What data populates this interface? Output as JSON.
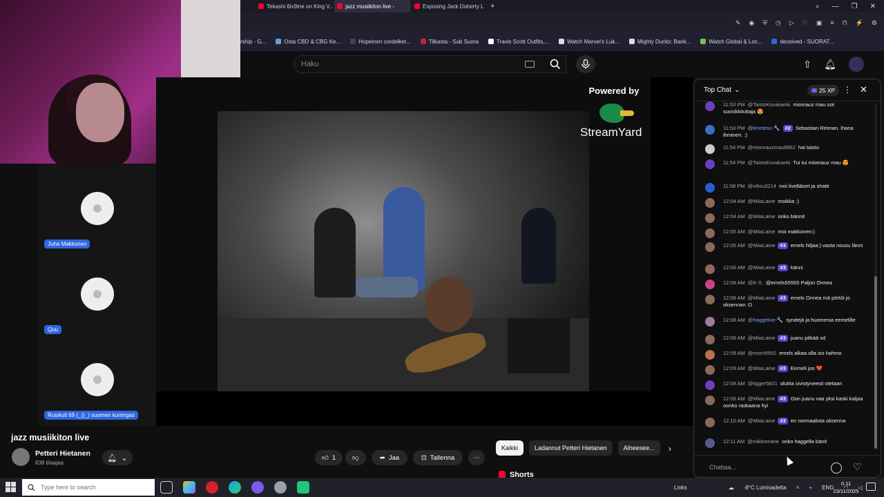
{
  "browser": {
    "tabs": [
      {
        "label": "Tekashi 6ix9ine on King V..."
      },
      {
        "label": "jazz musiikiton live -"
      },
      {
        "label": "Exposing Jack Doherty Ly..."
      }
    ],
    "new_tab": "+",
    "bookmarks": [
      "rship - G...",
      "Osta CBD & CBG Ke...",
      "Hopeinen cordelket...",
      "Tilkasta - Sub Suora",
      "Travis Scott Outfits,...",
      "Watch Marvel's Luk...",
      "Mighty Ducks: Bank...",
      "Watch Global & Loc...",
      "deceived - SUORAT..."
    ]
  },
  "youtube": {
    "search_placeholder": "Haku",
    "powered_by": "Powered by",
    "brand_text": "StreamYard",
    "participants": [
      {
        "name": "Juha Makkonen"
      },
      {
        "name": "Quu"
      },
      {
        "name": "Ruiskuli 69 (_()_) suomen kuningas"
      }
    ],
    "video_title": "jazz musiikiton live",
    "channel_name": "Petteri Hietanen",
    "subscribers": "838 tilaajaa",
    "likes": "1",
    "share_label": "Jaa",
    "save_label": "Tallenna",
    "filter_chips": [
      "Kaikki",
      "Ladannut Petteri Hietanen",
      "Aiheesee..."
    ],
    "shorts_label": "Shorts"
  },
  "chat": {
    "mode": "Top Chat",
    "xp": "25 XP",
    "input_placeholder": "Chattaa...",
    "messages": [
      {
        "time": "11:53 PM",
        "author": "@TaistoKovakanki",
        "badge": "",
        "text": "miomauz mau oot suosikkituttaja 😍",
        "avatar_color": "#6a3fc0"
      },
      {
        "time": "11:53 PM",
        "author": "@timeless-🔧",
        "badge": "#2",
        "text": "Sebastian Reiman. ihana ihminen. :)",
        "avatar_color": "#3b6fc4"
      },
      {
        "time": "11:54 PM",
        "author": "@miomauzmau8862",
        "badge": "",
        "text": "hai taisto",
        "avatar_color": "#cccccc"
      },
      {
        "time": "11:54 PM",
        "author": "@TaistoKovakanki",
        "badge": "",
        "text": "Tui tui miomauz mau 😍",
        "avatar_color": "#6a3fc0"
      },
      {
        "time": "11:58 PM",
        "author": "@viltsu3214",
        "badge": "",
        "text": "moi livelläiset ja shatti",
        "avatar_color": "#2b5cd6"
      },
      {
        "time": "12:04 AM",
        "author": "@MiiaLaine",
        "badge": "",
        "text": "moikka :)",
        "avatar_color": "#8a6a5a"
      },
      {
        "time": "12:04 AM",
        "author": "@MiiaLaine",
        "badge": "",
        "text": "onko bännit",
        "avatar_color": "#8a6a5a"
      },
      {
        "time": "12:05 AM",
        "author": "@MiiaLaine",
        "badge": "",
        "text": "moi makkonen:)",
        "avatar_color": "#8a6a5a"
      },
      {
        "time": "12:05 AM",
        "author": "@MiiaLaine",
        "badge": "#3",
        "text": "emels hiljaa:) vasta nousu länni",
        "avatar_color": "#8a6a5a"
      },
      {
        "time": "12:06 AM",
        "author": "@MiiaLaine",
        "badge": "#3",
        "text": "känni",
        "avatar_color": "#8a6a5a"
      },
      {
        "time": "12:08 AM",
        "author": "@K-S.",
        "badge": "",
        "text": "@emels55555 Paljon Onnea",
        "avatar_color": "#d0408a"
      },
      {
        "time": "12:08 AM",
        "author": "@MiiaLaine",
        "badge": "#3",
        "text": "emels Onnea mä pörtöl jo oksennan :D",
        "avatar_color": "#8a6a5a"
      },
      {
        "time": "12:08 AM",
        "author": "@haggelive-🔧",
        "badge": "",
        "text": "syndejä ja huomenia eemelille",
        "avatar_color": "#a07aa0"
      },
      {
        "time": "12:09 AM",
        "author": "@MiiaLaine",
        "badge": "#3",
        "text": "juanu pitkää xd",
        "avatar_color": "#8a6a5a"
      },
      {
        "time": "12:09 AM",
        "author": "@morri9562",
        "badge": "",
        "text": "emels alkaa olla iso hahmo",
        "avatar_color": "#c0704a"
      },
      {
        "time": "12:09 AM",
        "author": "@MiiaLaine",
        "badge": "#3",
        "text": "Eemeli joo ❤️",
        "avatar_color": "#8a6a5a"
      },
      {
        "time": "12:09 AM",
        "author": "@tigger5821",
        "badge": "",
        "text": "oluttia sivistyneesti otetaan",
        "avatar_color": "#6a3fc0"
      },
      {
        "time": "12:09 AM",
        "author": "@MiiaLaine",
        "badge": "#3",
        "text": "Oon juanu vaa yksi kaski kaljaa oonko raskaana hyi",
        "avatar_color": "#8a6a5a"
      },
      {
        "time": "12:10 AM",
        "author": "@MiiaLaine",
        "badge": "#3",
        "text": "en normaalista oksenna",
        "avatar_color": "#8a6a5a"
      },
      {
        "time": "12:11 AM",
        "author": "@mikkomane",
        "badge": "",
        "text": "onko haggella bänit",
        "avatar_color": "#555a88"
      }
    ]
  },
  "taskbar": {
    "search_placeholder": "Type here to search",
    "links": "Links",
    "weather": "-8°C  Lumisadetta",
    "lang": "ENG",
    "time": "0.11",
    "date": "23/11/2025"
  }
}
